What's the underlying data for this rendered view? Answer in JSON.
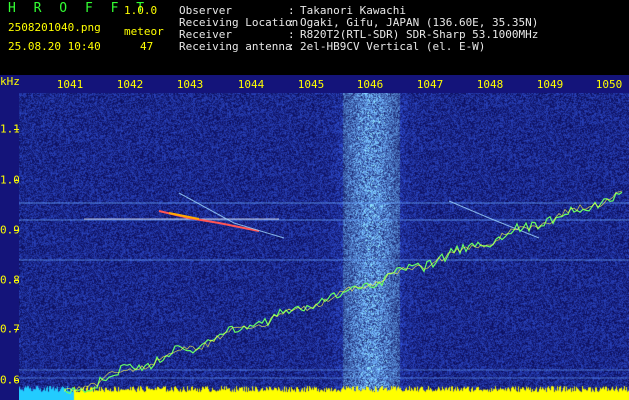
{
  "header": {
    "app_title": "H R O F F T",
    "version": "1.0.0",
    "filename": "2508201040.png",
    "datetime": "25.08.20 10:40",
    "meteor_label": "meteor",
    "meteor_count": "47",
    "info": [
      {
        "key": "Observer",
        "value": "Takanori Kawachi"
      },
      {
        "key": "Receiving Location",
        "value": "Ogaki, Gifu, JAPAN (136.60E, 35.35N)"
      },
      {
        "key": "Receiver",
        "value": "R820T2(RTL-SDR) SDR-Sharp 53.1000MHz"
      },
      {
        "key": "Receiving antenna",
        "value": "2el-HB9CV Vertical (el. E-W)"
      }
    ],
    "separator": ":"
  },
  "axes": {
    "x_unit": "kHz",
    "x_ticks": [
      "1041",
      "1042",
      "1043",
      "1044",
      "1045",
      "1046",
      "1047",
      "1048",
      "1049",
      "1050"
    ],
    "y_ticks": [
      "1.1",
      "1.0",
      "0.9",
      "0.8",
      "0.7",
      "0.6"
    ]
  },
  "colors": {
    "background": "#0a0a55",
    "noise": "#3a6cff",
    "carrier": "#9fd6ff",
    "trace": "#66ff66",
    "echo": "#ff4444",
    "baseline": "#ffff00",
    "floor": "#22ccff",
    "label": "#ffff00",
    "info_text": "#e8e8e8",
    "title_text": "#33ff33"
  }
}
